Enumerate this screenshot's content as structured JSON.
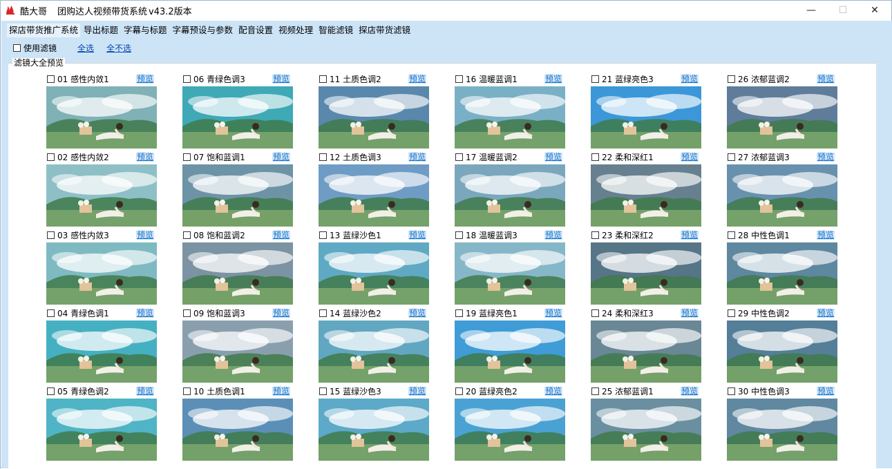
{
  "window": {
    "app_name": "酷大哥",
    "title": "团购达人视频带货系统",
    "version": "v43.2版本",
    "minimize": "—",
    "maximize": "☐",
    "close": "✕"
  },
  "menu": [
    {
      "label": "探店带货推广系统"
    },
    {
      "label": "导出标题"
    },
    {
      "label": "字幕与标题"
    },
    {
      "label": "字幕预设与参数"
    },
    {
      "label": "配音设置"
    },
    {
      "label": "视频处理"
    },
    {
      "label": "智能滤镜"
    },
    {
      "label": "探店带货滤镜"
    }
  ],
  "options": {
    "use_filter": "使用滤镜",
    "select_all": "全选",
    "select_none": "全不选"
  },
  "group_label": "滤镜大全预览",
  "preview_label": "预览",
  "filters": [
    {
      "name": "01 感性内敛1",
      "tint": "#7fb1b6"
    },
    {
      "name": "06 青绿色调3",
      "tint": "#3fa9b6"
    },
    {
      "name": "11 土质色调2",
      "tint": "#5a88ac"
    },
    {
      "name": "16 温暖蓝调1",
      "tint": "#7ab0c6"
    },
    {
      "name": "21 蓝绿亮色3",
      "tint": "#3b97d8"
    },
    {
      "name": "26 浓郁蓝调2",
      "tint": "#5f7d9a"
    },
    {
      "name": "02 感性内敛2",
      "tint": "#8fbfc6"
    },
    {
      "name": "07 饱和蓝调1",
      "tint": "#6d93a6"
    },
    {
      "name": "12 土质色调3",
      "tint": "#6f9cc4"
    },
    {
      "name": "17 温暖蓝调2",
      "tint": "#7aa7bc"
    },
    {
      "name": "22 柔和深红1",
      "tint": "#66808f"
    },
    {
      "name": "27 浓郁蓝调3",
      "tint": "#6891ae"
    },
    {
      "name": "03 感性内敛3",
      "tint": "#7fbac2"
    },
    {
      "name": "08 饱和蓝调2",
      "tint": "#7b93a3"
    },
    {
      "name": "13 蓝绿沙色1",
      "tint": "#5fa9c4"
    },
    {
      "name": "18 温暖蓝调3",
      "tint": "#86b7c8"
    },
    {
      "name": "23 柔和深红2",
      "tint": "#567587"
    },
    {
      "name": "28 中性色调1",
      "tint": "#5e87a0"
    },
    {
      "name": "04 青绿色调1",
      "tint": "#45b0c1"
    },
    {
      "name": "09 饱和蓝调3",
      "tint": "#8a9fae"
    },
    {
      "name": "14 蓝绿沙色2",
      "tint": "#62a7c1"
    },
    {
      "name": "19 蓝绿亮色1",
      "tint": "#3f9cd6"
    },
    {
      "name": "24 柔和深红3",
      "tint": "#6a8796"
    },
    {
      "name": "29 中性色调2",
      "tint": "#557e98"
    },
    {
      "name": "05 青绿色调2",
      "tint": "#4fb4c6"
    },
    {
      "name": "10 土质色调1",
      "tint": "#5b8fb7"
    },
    {
      "name": "15 蓝绿沙色3",
      "tint": "#5ca9c9"
    },
    {
      "name": "20 蓝绿亮色2",
      "tint": "#4aa2d4"
    },
    {
      "name": "25 浓郁蓝调1",
      "tint": "#6a8fa0"
    },
    {
      "name": "30 中性色调3",
      "tint": "#6088a0"
    }
  ]
}
